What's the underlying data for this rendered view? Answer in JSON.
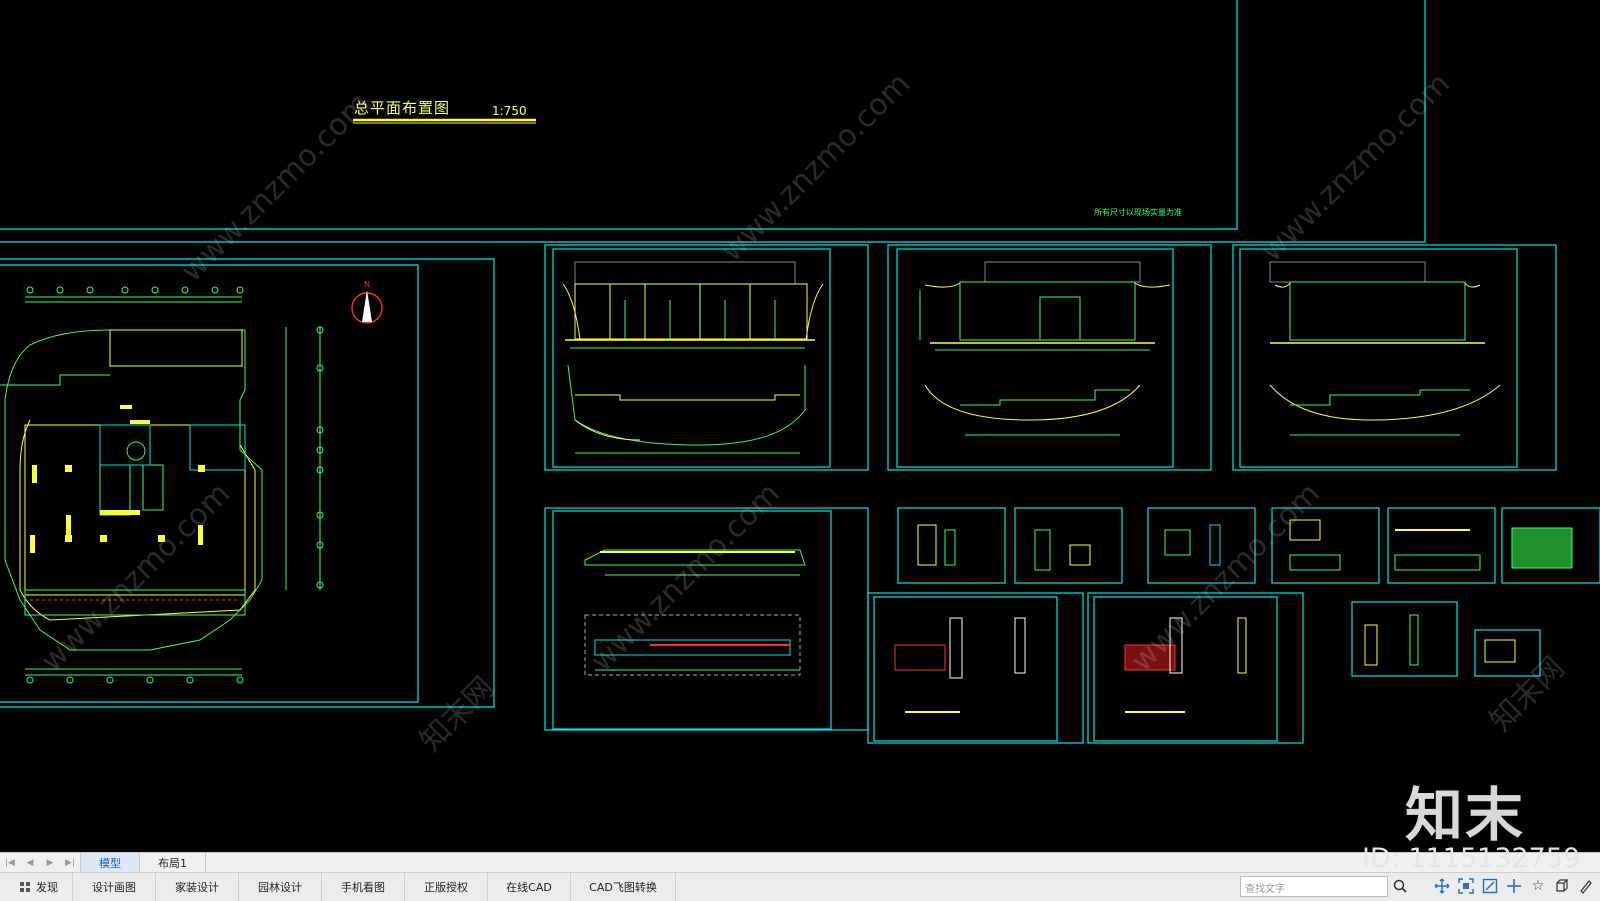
{
  "drawing": {
    "title": "总平面布置图",
    "scale": "1:750",
    "note": "所有尺寸以现场实量为准",
    "north_label": "N"
  },
  "watermarks": {
    "site": "www.znzmo.com",
    "brand_cn": "知末网",
    "brand": "知末",
    "image_id": "ID: 1115132759"
  },
  "tabs": {
    "nav_icons": [
      "first-icon",
      "prev-icon",
      "next-icon",
      "last-icon"
    ],
    "items": [
      {
        "label": "模型",
        "active": true
      },
      {
        "label": "布局1",
        "active": false
      }
    ]
  },
  "toolbar": {
    "discover": "发现",
    "design_drawing": "设计画图",
    "home_design": "家装设计",
    "garden_design": "园林设计",
    "mobile_view": "手机看图",
    "license": "正版授权",
    "online_cad": "在线CAD",
    "cad_convert": "CAD飞图转换"
  },
  "search": {
    "placeholder": "查找文字"
  },
  "right_tools": [
    "search-icon",
    "pan-icon",
    "zoom-extents-icon",
    "zoom-window-icon",
    "crosshair-icon",
    "star-icon",
    "3d-view-icon",
    "brush-icon"
  ],
  "colors": {
    "canvas": "#000000",
    "frame": "#00e5e5",
    "line_yellow": "#ffff33",
    "line_green": "#33ff66",
    "line_red": "#ff3030",
    "tab_active": "#1a5fb4"
  }
}
